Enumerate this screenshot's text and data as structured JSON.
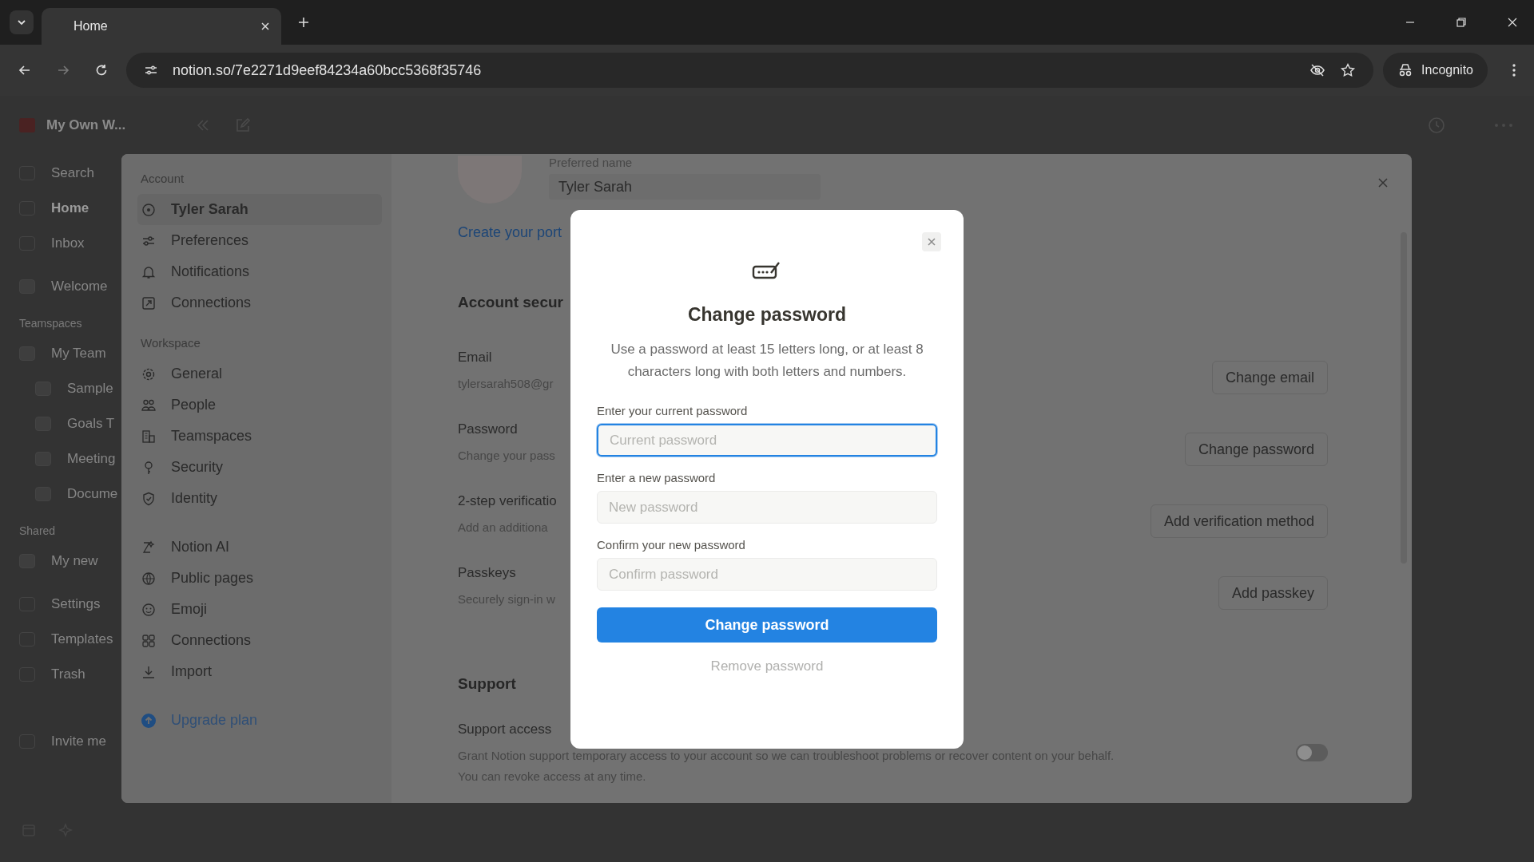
{
  "browser": {
    "tabs": [
      {
        "title": "Home",
        "selected": true
      }
    ],
    "url": "notion.so/7e2271d9eef84234a60bcc5368f35746",
    "profile_label": "Incognito"
  },
  "app_sidebar": {
    "workspace_name": "My Own W...",
    "items": [
      {
        "label": "Search",
        "selected": false
      },
      {
        "label": "Home",
        "selected": true
      },
      {
        "label": "Inbox",
        "selected": false
      }
    ],
    "pages": [
      {
        "label": "Welcome"
      }
    ],
    "sections": [
      {
        "title": "Teamspaces",
        "items": [
          {
            "label": "My Team",
            "children": [
              {
                "label": "Sample"
              },
              {
                "label": "Goals T"
              },
              {
                "label": "Meeting"
              },
              {
                "label": "Docume"
              }
            ]
          }
        ]
      },
      {
        "title": "Shared",
        "items": [
          {
            "label": "My new"
          }
        ]
      }
    ],
    "footer_items": [
      {
        "label": "Settings"
      },
      {
        "label": "Templates"
      },
      {
        "label": "Trash"
      }
    ],
    "invite_label": "Invite me"
  },
  "settings_nav": {
    "groups": [
      {
        "title": "Account",
        "items": [
          {
            "label": "Tyler Sarah",
            "selected": true
          },
          {
            "label": "Preferences",
            "selected": false
          },
          {
            "label": "Notifications",
            "selected": false
          },
          {
            "label": "Connections",
            "selected": false
          }
        ]
      },
      {
        "title": "Workspace",
        "items": [
          {
            "label": "General",
            "selected": false
          },
          {
            "label": "People",
            "selected": false
          },
          {
            "label": "Teamspaces",
            "selected": false
          },
          {
            "label": "Security",
            "selected": false
          },
          {
            "label": "Identity",
            "selected": false
          }
        ]
      },
      {
        "items": [
          {
            "label": "Notion AI",
            "selected": false
          },
          {
            "label": "Public pages",
            "selected": false
          },
          {
            "label": "Emoji",
            "selected": false
          },
          {
            "label": "Connections",
            "selected": false
          },
          {
            "label": "Import",
            "selected": false
          }
        ]
      }
    ],
    "upgrade_label": "Upgrade plan"
  },
  "profile": {
    "name_label": "Preferred name",
    "name_value": "Tyler Sarah",
    "portrait_link": "Create your port"
  },
  "security": {
    "heading": "Account secur",
    "rows": [
      {
        "title": "Email",
        "description": "tylersarah508@gr",
        "button": "Change email"
      },
      {
        "title": "Password",
        "description": "Change your pass",
        "button": "Change password"
      },
      {
        "title": "2-step verificatio",
        "description": "Add an additiona",
        "button": "Add verification method"
      },
      {
        "title": "Passkeys",
        "description": "Securely sign-in w",
        "button": "Add passkey"
      }
    ]
  },
  "support": {
    "heading": "Support",
    "rows": [
      {
        "title": "Support access",
        "description": "Grant Notion support temporary access to your account so we can troubleshoot problems or recover content on your behalf. You can revoke access at any time.",
        "on": false
      }
    ]
  },
  "modal": {
    "title": "Change password",
    "description": "Use a password at least 15 letters long, or at least 8 characters long with both letters and numbers.",
    "fields": [
      {
        "label": "Enter your current password",
        "placeholder": "Current password",
        "focused": true
      },
      {
        "label": "Enter a new password",
        "placeholder": "New password",
        "focused": false
      },
      {
        "label": "Confirm your new password",
        "placeholder": "Confirm password",
        "focused": false
      }
    ],
    "submit": "Change password",
    "secondary": "Remove password"
  }
}
